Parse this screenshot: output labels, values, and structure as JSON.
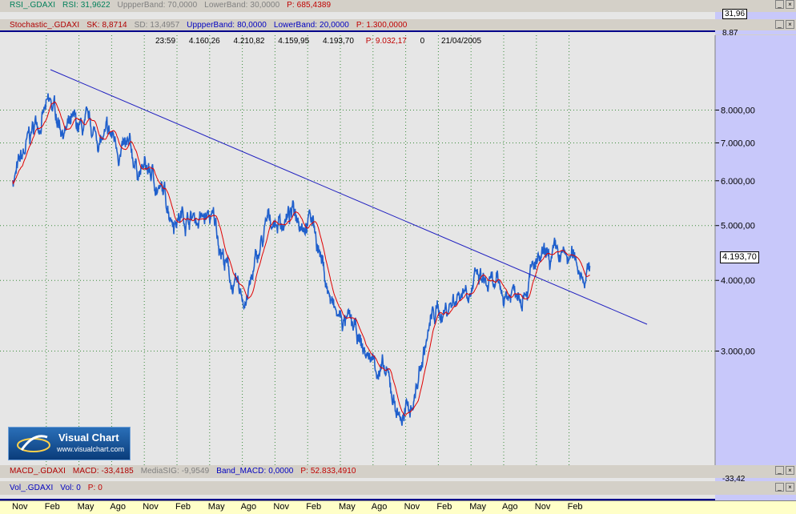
{
  "rsi_header": {
    "name": "RSI_.GDAXI",
    "rsi": "RSI: 31,9622",
    "upper": "UppperBand: 70,0000",
    "lower": "LowerBand: 30,0000",
    "p": "P: 685,4389",
    "value_box": "31,96"
  },
  "stoch_header": {
    "name": "Stochastic_.GDAXI",
    "sk": "SK: 8,8714",
    "sd": "SD: 13,4957",
    "upper": "UppperBand: 80,0000",
    "lower": "LowerBand: 20,0000",
    "p": "P: 1.300,0000",
    "value_box": "8,87"
  },
  "price_header": {
    "time": "23:59",
    "open": "4.160,26",
    "high": "4.210,82",
    "low": "4.159,95",
    "close": "4.193,70",
    "p": "P: 9.032,17",
    "vol": "0",
    "date": "21/04/2005"
  },
  "last_price_box": "4.193,70",
  "macd_header": {
    "name": "MACD_.GDAXI",
    "macd": "MACD: -33,4185",
    "sig": "MediaSIG: -9,9549",
    "band": "Band_MACD: 0,0000",
    "p": "P: 52.833,4910",
    "value_box": "-33,42"
  },
  "vol_header": {
    "name": "Vol_.GDAXI",
    "vol": "Vol: 0",
    "p": "P: 0"
  },
  "logo": {
    "title": "Visual Chart",
    "url": "www.visualchart.com"
  },
  "chart_data": {
    "type": "line",
    "series": [
      {
        "name": "GDAXI",
        "x": [
          "2000-11",
          "2001-02",
          "2001-05",
          "2001-08",
          "2001-11",
          "2002-02",
          "2002-05",
          "2002-08",
          "2002-11",
          "2003-02",
          "2003-05",
          "2003-08",
          "2003-11",
          "2004-02",
          "2004-05",
          "2004-08",
          "2004-11",
          "2005-02",
          "2005-04"
        ],
        "values": [
          6100,
          7950,
          7250,
          7000,
          6250,
          5300,
          5100,
          3700,
          5100,
          5300,
          3400,
          2900,
          2300,
          3500,
          4000,
          3750,
          4200,
          4300,
          4193.7
        ]
      }
    ],
    "yticks": [
      "3.000,00",
      "4.000,00",
      "5.000,00",
      "6.000,00",
      "7.000,00",
      "8.000,00"
    ],
    "yscale": "log",
    "xticks": [
      "Nov",
      "Feb",
      "May",
      "Ago",
      "Nov",
      "Feb",
      "May",
      "Ago",
      "Nov",
      "Feb",
      "May",
      "Ago",
      "Nov",
      "Feb",
      "May",
      "Ago",
      "Nov",
      "Feb"
    ]
  },
  "colors": {
    "price": "#1f5fcc",
    "average": "#e00000",
    "trendline": "#2020c0",
    "panel_bg": "#e6e6e6",
    "scale_bg": "#c8c8fa"
  }
}
